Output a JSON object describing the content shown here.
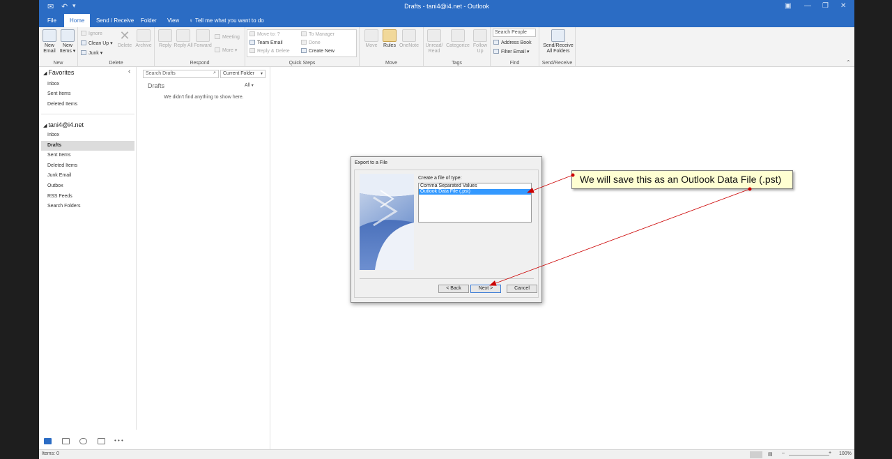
{
  "titlebar": {
    "title": "Drafts - tani4@i4.net  -  Outlook",
    "undo_glyph": "↶",
    "qa_menu_glyph": "▾",
    "min_glyph": "—",
    "restore_glyph": "❐",
    "close_glyph": "✕"
  },
  "tabs": [
    {
      "label": "File"
    },
    {
      "label": "Home"
    },
    {
      "label": "Send / Receive"
    },
    {
      "label": "Folder"
    },
    {
      "label": "View"
    }
  ],
  "tellme": "Tell me what you want to do",
  "ribbon": {
    "new_email": "New Email",
    "new_items": "New Items ▾",
    "ignore": "Ignore",
    "clean_up": "Clean Up ▾",
    "junk": "Junk ▾",
    "delete": "Delete",
    "archive": "Archive",
    "reply": "Reply",
    "reply_all": "Reply All",
    "forward": "Forward",
    "meeting": "Meeting",
    "more": "More ▾",
    "move_to": "Move to: ?",
    "to_manager": "To Manager",
    "team_email": "Team Email",
    "done": "Done",
    "reply_delete": "Reply & Delete",
    "create_new": "Create New",
    "move": "Move",
    "rules": "Rules",
    "onenote": "OneNote",
    "unread_read": "Unread/ Read",
    "categorize": "Categorize",
    "follow_up": "Follow Up",
    "search_people": "Search People",
    "address_book": "Address Book",
    "filter_email": "Filter Email ▾",
    "send_receive_all": "Send/Receive All Folders",
    "groups": {
      "new": "New",
      "delete": "Delete",
      "respond": "Respond",
      "quick_steps": "Quick Steps",
      "move": "Move",
      "tags": "Tags",
      "find": "Find",
      "send_receive": "Send/Receive"
    }
  },
  "nav": {
    "favorites_header": "Favorites",
    "favorites": [
      {
        "label": "Inbox"
      },
      {
        "label": "Sent Items"
      },
      {
        "label": "Deleted Items"
      }
    ],
    "account_header": "tani4@i4.net",
    "account_items": [
      {
        "label": "Inbox"
      },
      {
        "label": "Drafts"
      },
      {
        "label": "Sent Items"
      },
      {
        "label": "Deleted Items"
      },
      {
        "label": "Junk Email"
      },
      {
        "label": "Outbox"
      },
      {
        "label": "RSS Feeds"
      },
      {
        "label": "Search Folders"
      }
    ],
    "more_glyph": "• • •"
  },
  "message_list": {
    "search_placeholder": "Search Drafts",
    "scope": "Current Folder",
    "folder_title": "Drafts",
    "filter": "All",
    "empty_text": "We didn't find anything to show here."
  },
  "dialog": {
    "title": "Export to a File",
    "prompt": "Create a file of type:",
    "options": [
      {
        "label": "Comma Separated Values"
      },
      {
        "label": "Outlook Data File (.pst)"
      }
    ],
    "selected_index": 1,
    "back_label": "< Back",
    "next_label": "Next >",
    "cancel_label": "Cancel"
  },
  "callout": {
    "text": "We will save this as an Outlook Data File (.pst)"
  },
  "statusbar": {
    "items": "Items: 0",
    "zoom": "100%"
  },
  "colors": {
    "accent": "#2b6cc4",
    "selection": "#3399ff",
    "callout_bg": "#ffffd2",
    "arrow": "#cc0000"
  }
}
